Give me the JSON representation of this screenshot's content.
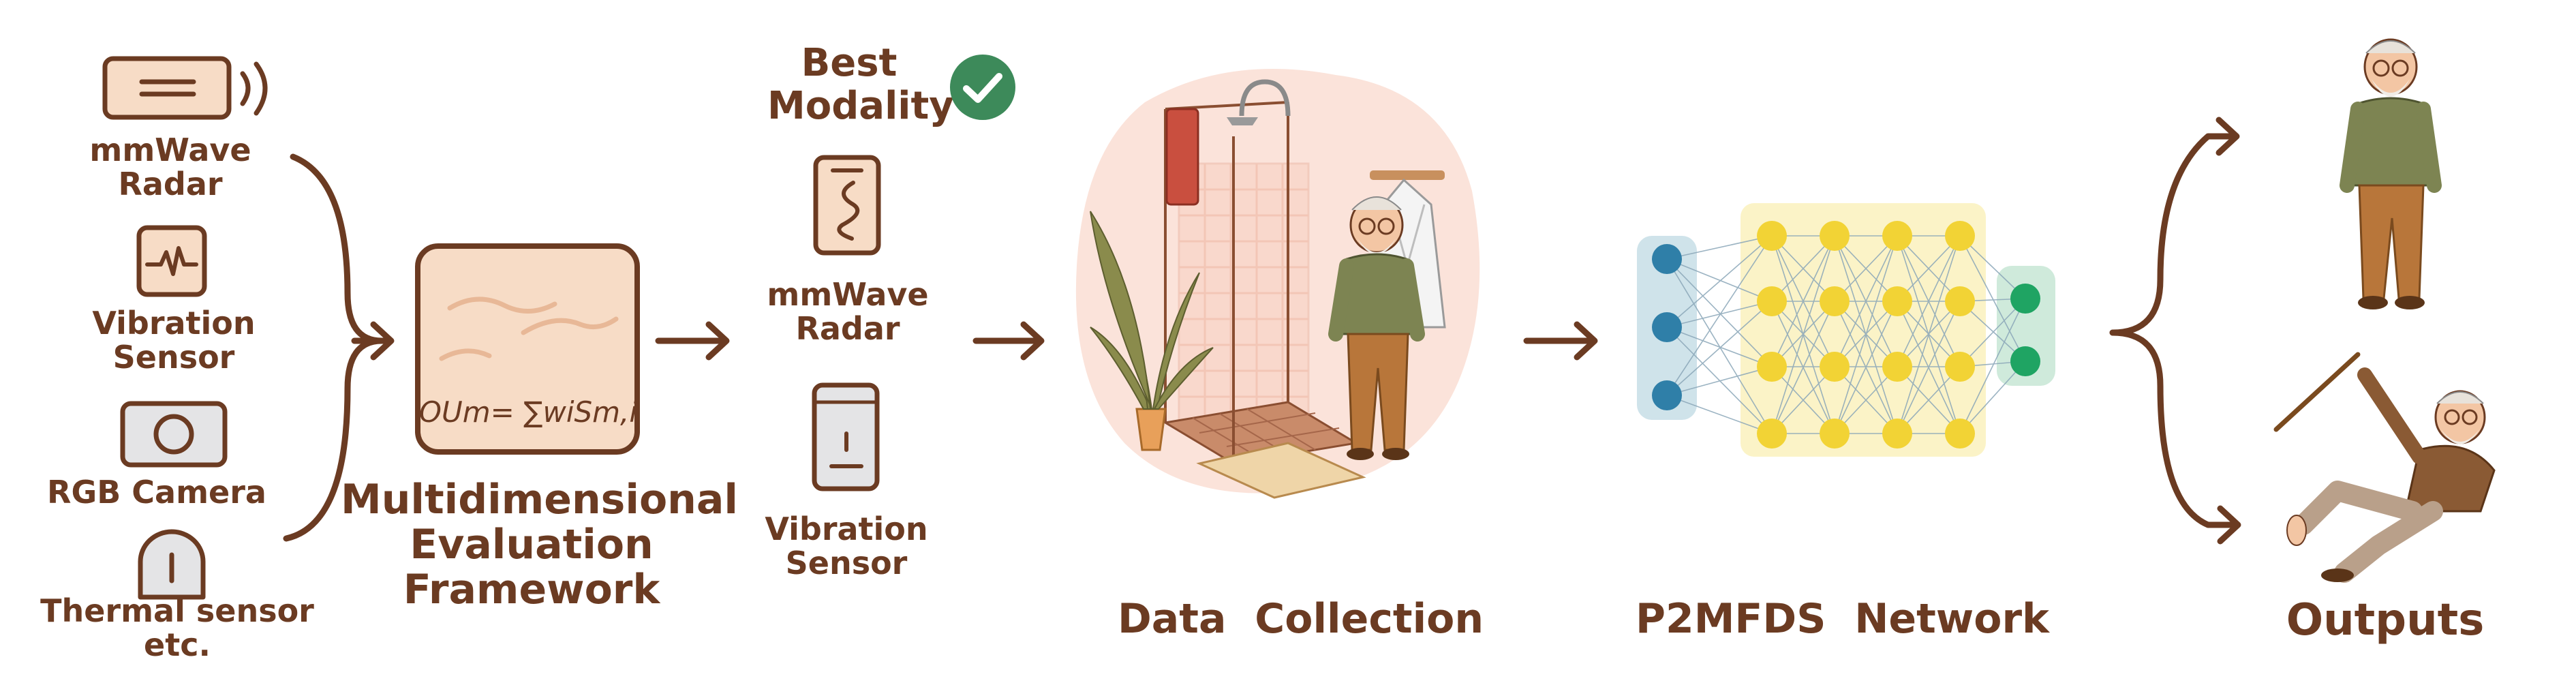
{
  "sensors": {
    "mmwave_label_1": "mmWave",
    "mmwave_label_2": "Radar",
    "vibration_label_1": "Vibration",
    "vibration_label_2": "Sensor",
    "rgb_label": "RGB Camera",
    "thermal_label_1": "Thermal sensor",
    "thermal_label_2": "etc."
  },
  "framework": {
    "formula": "OUm= ∑wiSm,i",
    "title_line_1": "Multidimensional",
    "title_line_2": "Evaluation",
    "title_line_3": "Framework"
  },
  "selection": {
    "best_line_1": "Best",
    "best_line_2": "Modality",
    "mmwave_label_1": "mmWave",
    "mmwave_label_2": "Radar",
    "vibration_label_1": "Vibration",
    "vibration_label_2": "Sensor"
  },
  "stages": {
    "data_collection": "Data  Collection",
    "network": "P2MFDS  Network",
    "outputs": "Outputs"
  },
  "colors": {
    "ink": "#6b3b22",
    "card_fill": "#f7dcc6",
    "check_green": "#3d8a5a",
    "network_input": "#2f7fa8",
    "network_hidden": "#f2d335",
    "network_output": "#1fa463"
  },
  "icons": [
    "radar-icon",
    "vibration-sensor-icon",
    "camera-icon",
    "thermal-sensor-icon",
    "check-icon",
    "bathroom-scene",
    "neural-network",
    "standing-person-icon",
    "falling-person-icon"
  ]
}
